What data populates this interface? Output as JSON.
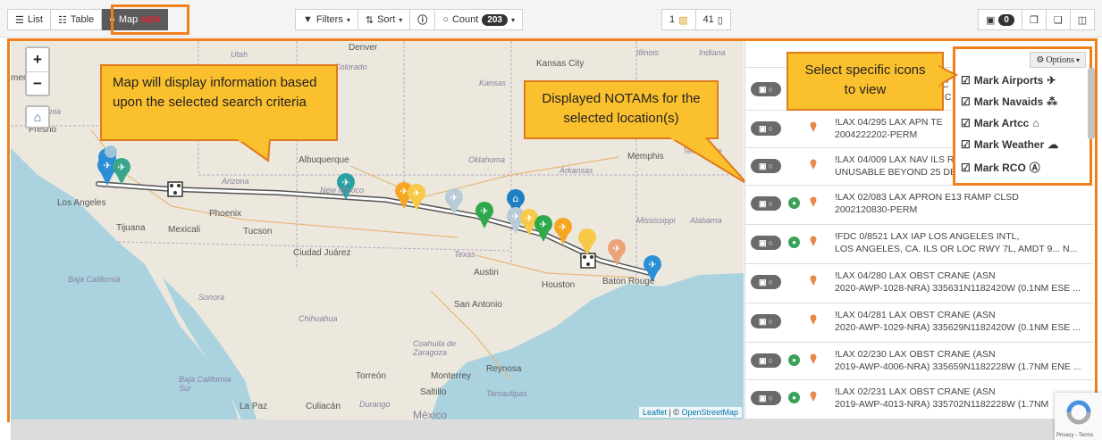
{
  "toolbar": {
    "view_tabs": [
      {
        "label": "List",
        "icon": "list-icon"
      },
      {
        "label": "Table",
        "icon": "table-icon"
      },
      {
        "label": "Map",
        "icon": "globe-icon",
        "badge": "NEW"
      }
    ],
    "filters_label": "Filters",
    "sort_label": "Sort",
    "count_label": "Count",
    "count_value": "203",
    "pinned_count": "1",
    "notam_count": "41",
    "export_badge": "0"
  },
  "map": {
    "labels": [
      "Utah",
      "Colorado",
      "Denver",
      "Kansas City",
      "Illinois",
      "Indiana",
      "mento",
      "California",
      "Fresno",
      "Kansas",
      "Albuquerque",
      "Oklahoma",
      "Memphis",
      "Tennessee",
      "Arkansas",
      "Arizona",
      "New Mexico",
      "Los Angeles",
      "Tijuana",
      "Mexicali",
      "Phoenix",
      "Tucson",
      "Mississippi",
      "Alabama",
      "Ciudad Juárez",
      "Texas",
      "Austin",
      "Houston",
      "Baton Rouge",
      "Baja California",
      "Sonora",
      "Chihuahua",
      "San Antonio",
      "Coahuila de Zaragoza",
      "Monterrey",
      "Reynosa",
      "Torreón",
      "Saltillo",
      "Tamaulipas",
      "Baja California Sur",
      "La Paz",
      "Culiacán",
      "Durango",
      "México"
    ],
    "attribution_leaflet": "Leaflet",
    "attribution_sep": " | © ",
    "attribution_osm": "OpenStreetMap",
    "zoom_in": "+",
    "zoom_out": "−"
  },
  "callouts": {
    "map_info": "Map will display information based upon the selected search criteria",
    "notams": "Displayed NOTAMs for the selected location(s)",
    "icons": "Select specific icons to view"
  },
  "options": {
    "button_label": "Options",
    "items": [
      {
        "label": "Mark Airports",
        "icon": "airplane-icon"
      },
      {
        "label": "Mark Navaids",
        "icon": "navaid-icon"
      },
      {
        "label": "Mark Artcc",
        "icon": "building-icon"
      },
      {
        "label": "Mark Weather",
        "icon": "cloud-icon"
      },
      {
        "label": "Mark RCO",
        "icon": "antenna-icon"
      }
    ]
  },
  "notams": [
    {
      "line1": "!LAX 04/295 LAX AP",
      "line1_tail": "N TE",
      "line2": "2004222202-PERM",
      "dot": false
    },
    {
      "line1": "!LAX 04/009 LAX NAV ILS R",
      "line1_tail": "",
      "line2": "UNUSABLE BEYOND 25 DE",
      "dot": false
    },
    {
      "line1": "!LAX 02/083 LAX APRON E13 RAMP CLSD",
      "line1_tail": "",
      "line2": "2002120830-PERM",
      "dot": true
    },
    {
      "line1": "!FDC 0/8521 LAX IAP LOS ANGELES INTL,",
      "line1_tail": "",
      "line2": "LOS ANGELES, CA. ILS OR LOC RWY 7L, AMDT 9... N...",
      "dot": true
    },
    {
      "line1": "!LAX 04/280 LAX OBST CRANE (ASN",
      "line1_tail": "",
      "line2": "2020-AWP-1028-NRA) 335631N1182420W (0.1NM ESE ...",
      "dot": false
    },
    {
      "line1": "!LAX 04/281 LAX OBST CRANE (ASN",
      "line1_tail": "",
      "line2": "2020-AWP-1029-NRA) 335629N1182420W (0.1NM ESE ...",
      "dot": false
    },
    {
      "line1": "!LAX 02/230 LAX OBST CRANE (ASN",
      "line1_tail": "",
      "line2": "2019-AWP-4006-NRA) 335659N1182228W (1.7NM ENE ...",
      "dot": true
    },
    {
      "line1": "!LAX 02/231 LAX OBST CRANE (ASN",
      "line1_tail": "",
      "line2": "2019-AWP-4013-NRA) 335702N1182228W (1.7NM",
      "dot": true
    }
  ],
  "notam_partial": [
    "C",
    "IC"
  ],
  "recaptcha_text": "Privacy - Terms",
  "colors": {
    "accent": "#f07f1c",
    "callout": "#fbc02d",
    "toggle": "#6a6a6a",
    "green": "#3aa15a"
  }
}
